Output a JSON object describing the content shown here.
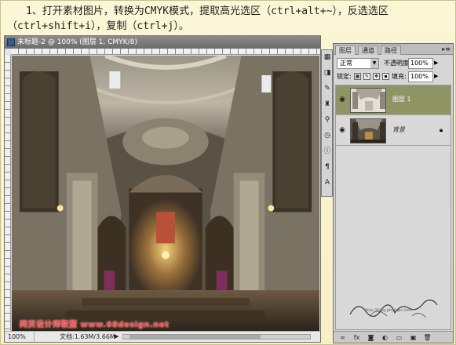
{
  "instructions": {
    "text": "1、打开素材图片，转换为CMYK模式，提取高光选区（ctrl+alt+~），反选选区（ctrl+shift+i），复制（ctrl+j）。"
  },
  "document": {
    "title": "未标题-2 @ 100% (图层 1, CMYK/8)",
    "zoom": "100%",
    "doc_size": "文档:1.63M/3.66M",
    "watermark": "网页设计师联盟 www.68design.net"
  },
  "tools": {
    "icons": [
      "grid-icon",
      "layers-icon",
      "brush-icon",
      "stamp-icon",
      "eyedropper-icon",
      "history-icon",
      "info-icon",
      "paragraph-icon",
      "text-icon"
    ]
  },
  "layers_panel": {
    "tabs": [
      "图层",
      "通道",
      "路径"
    ],
    "active_tab": "图层",
    "blend_mode": "正常",
    "opacity_label": "不透明度:",
    "opacity_value": "100%",
    "lock_label": "锁定:",
    "fill_label": "填充:",
    "fill_value": "100%",
    "layers": [
      {
        "name": "图层 1",
        "selected": true,
        "visible": true,
        "locked": false
      },
      {
        "name": "背景",
        "selected": false,
        "visible": true,
        "locked": true
      }
    ]
  },
  "signature": {
    "url": "http://blog.photops.com"
  },
  "colors": {
    "background": "#fbf6d6",
    "selected_layer": "#8f9464",
    "watermark_red": "#ff3b3b"
  }
}
